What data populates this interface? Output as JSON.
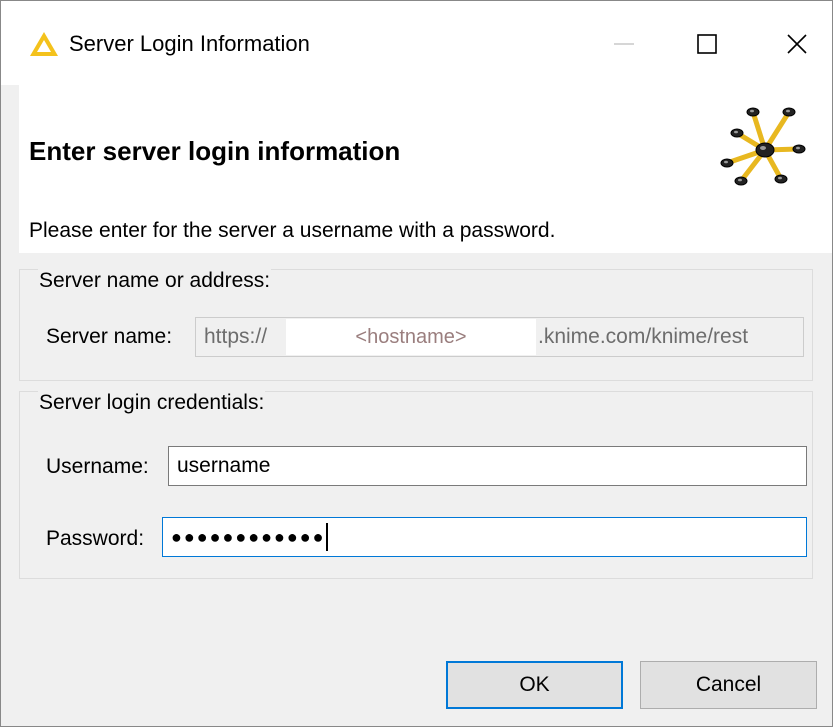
{
  "window": {
    "title": "Server Login Information",
    "controls": [
      "minimize-icon",
      "maximize-icon",
      "close-icon"
    ]
  },
  "banner": {
    "title": "Enter server login information",
    "message": "Please enter for the server a username with  a password."
  },
  "server_group": {
    "legend": "Server name or address:",
    "server_name_label": "Server name:",
    "server_url_prefix": "https://",
    "server_url_host_placeholder": "<hostname>",
    "server_url_suffix": ".knime.com/knime/rest"
  },
  "credentials_group": {
    "legend": "Server login credentials:",
    "username_label": "Username:",
    "username_value": "username",
    "password_label": "Password:",
    "password_masked": "●●●●●●●●●●●●"
  },
  "buttons": {
    "ok": "OK",
    "cancel": "Cancel"
  },
  "colors": {
    "accent": "#0078d7",
    "title_icon": "#f4c21c",
    "banner_bg": "#ffffff",
    "dialog_bg": "#f0f0f0"
  }
}
